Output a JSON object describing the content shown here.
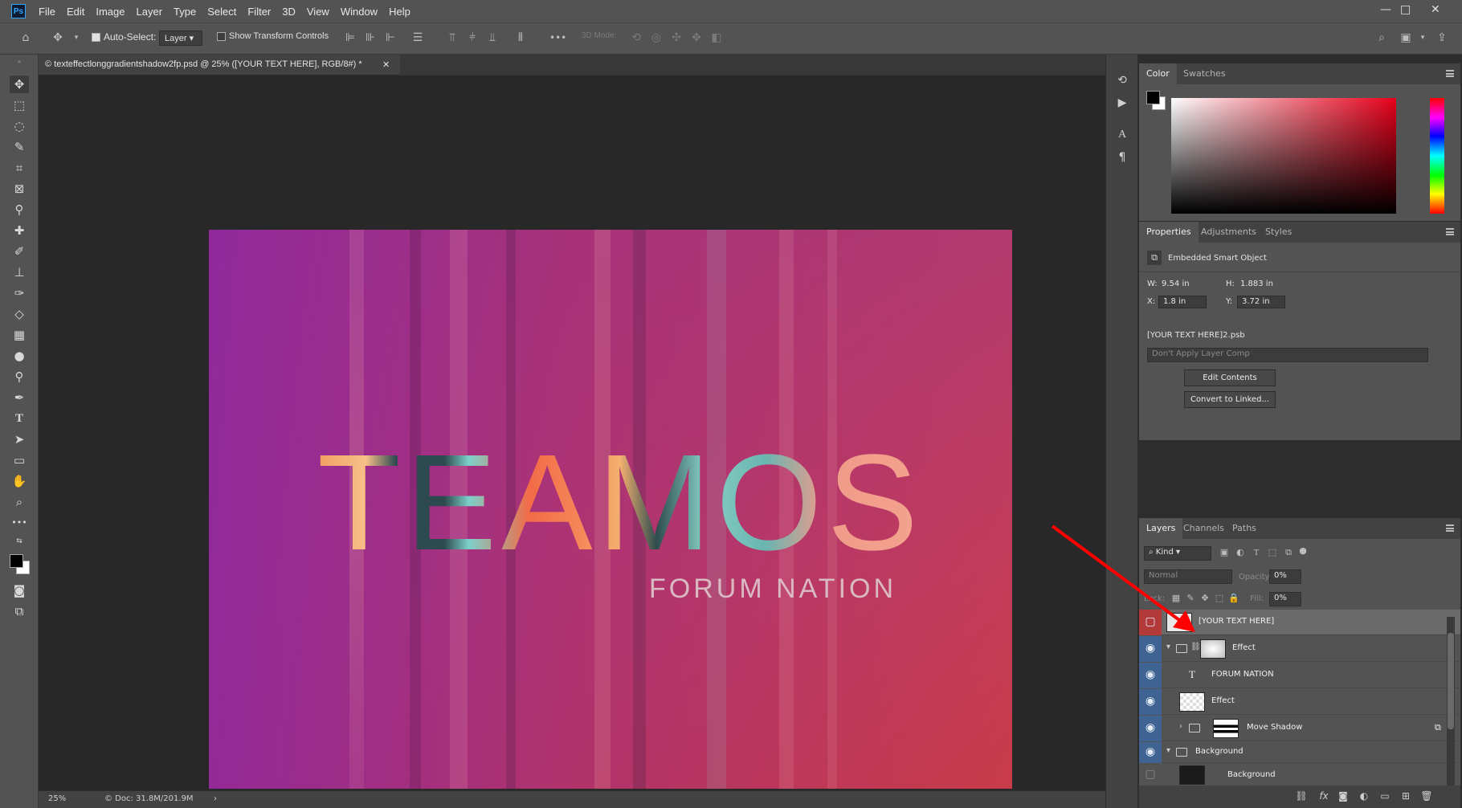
{
  "app": {
    "logo": "Ps",
    "menu": [
      "File",
      "Edit",
      "Image",
      "Layer",
      "Type",
      "Select",
      "Filter",
      "3D",
      "View",
      "Window",
      "Help"
    ],
    "window_controls": {
      "minimize": "—",
      "maximize": "□",
      "close": "✕"
    }
  },
  "options_bar": {
    "auto_select_label": "Auto-Select:",
    "auto_select_checked": true,
    "auto_select_target": "Layer",
    "show_transform_label": "Show Transform Controls",
    "show_transform_checked": false,
    "more_label": "•••",
    "mode_3d_label": "3D Mode:"
  },
  "document": {
    "tab_title": "© texteffectlonggradientshadow2fp.psd @ 25% ([YOUR TEXT HERE], RGB/8#) *",
    "close_glyph": "✕",
    "canvas_title": "TEAMOS",
    "canvas_subtitle": "FORUM NATION",
    "zoom": "25%",
    "doc_info": "© Doc: 31.8M/201.9M",
    "status_arrow": "›"
  },
  "tools": [
    "move-tool",
    "marquee-tool",
    "lasso-tool",
    "quick-select-tool",
    "crop-tool",
    "frame-tool",
    "eyedropper-tool",
    "healing-tool",
    "brush-tool",
    "stamp-tool",
    "history-brush-tool",
    "eraser-tool",
    "gradient-tool",
    "blur-tool",
    "dodge-tool",
    "pen-tool",
    "type-tool",
    "path-select-tool",
    "rectangle-tool",
    "hand-tool",
    "zoom-tool",
    "more-tools"
  ],
  "type_tool_glyph": "T",
  "more_tools_glyph": "•••",
  "colors": {
    "foreground": "#000000",
    "background": "#ffffff",
    "accent_blue": "#3f6493",
    "accent_red": "#b23a3a",
    "annotation_arrow": "#ff0000"
  },
  "color_panel": {
    "tabs": [
      "Color",
      "Swatches"
    ],
    "active_tab": "Color"
  },
  "properties_panel": {
    "tabs": [
      "Properties",
      "Adjustments",
      "Styles"
    ],
    "active_tab": "Properties",
    "object_type": "Embedded Smart Object",
    "w_label": "W:",
    "w_value": "9.54 in",
    "h_label": "H:",
    "h_value": "1.883 in",
    "x_label": "X:",
    "x_value": "1.8 in",
    "y_label": "Y:",
    "y_value": "3.72 in",
    "file_name": "[YOUR TEXT HERE]2.psb",
    "layer_comp": "Don't Apply Layer Comp",
    "edit_contents": "Edit Contents",
    "convert_linked": "Convert to Linked..."
  },
  "layers_panel": {
    "tabs": [
      "Layers",
      "Channels",
      "Paths"
    ],
    "active_tab": "Layers",
    "filter_kind": "Kind",
    "blend_mode": "Normal",
    "opacity_label": "Opacity:",
    "opacity_value": "0%",
    "lock_label": "Lock:",
    "fill_label": "Fill:",
    "fill_value": "0%",
    "layers": [
      {
        "name": "[YOUR TEXT HERE]",
        "kind": "smart-object",
        "visible": false,
        "selected": true
      },
      {
        "name": "Effect",
        "kind": "group-mask",
        "visible": true,
        "selected": false
      },
      {
        "name": "FORUM NATION",
        "kind": "text",
        "visible": true,
        "selected": false
      },
      {
        "name": "Effect",
        "kind": "smart-object",
        "visible": true,
        "selected": false
      },
      {
        "name": "Move Shadow",
        "kind": "group",
        "visible": true,
        "selected": false
      },
      {
        "name": "Background",
        "kind": "group",
        "visible": true,
        "selected": false
      },
      {
        "name": "Background",
        "kind": "image",
        "visible": false,
        "selected": false
      }
    ]
  }
}
